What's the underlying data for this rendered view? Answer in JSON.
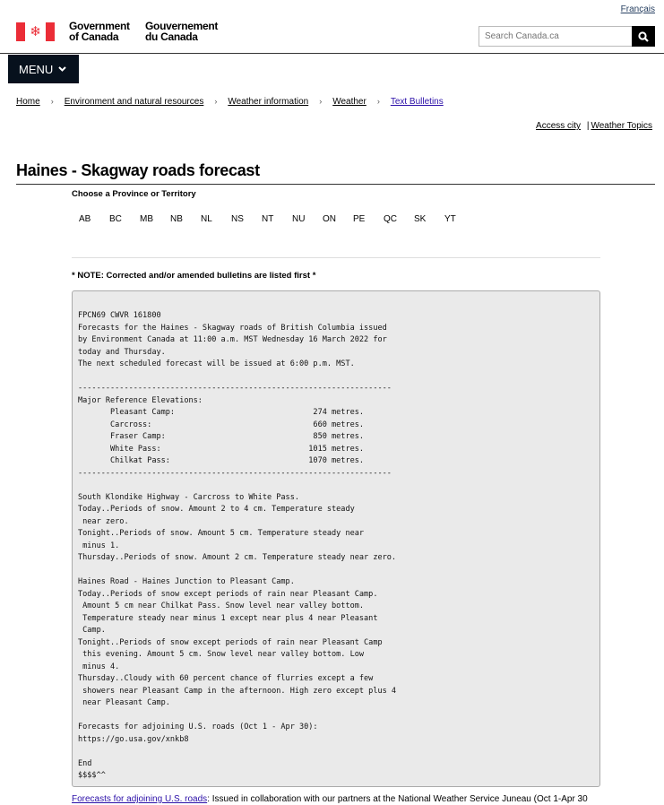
{
  "header": {
    "lang_link": "Français",
    "gov_en_1": "Government",
    "gov_en_2": "of Canada",
    "gov_fr_1": "Gouvernement",
    "gov_fr_2": "du Canada",
    "search_placeholder": "Search Canada.ca",
    "menu_label": "MENU"
  },
  "breadcrumb": [
    "Home",
    "Environment and natural resources",
    "Weather information",
    "Weather",
    "Text Bulletins"
  ],
  "top_links": {
    "access_city": "Access city",
    "sep": "|",
    "weather_topics": "Weather Topics"
  },
  "page_title": "Haines - Skagway roads forecast",
  "province_title": "Choose a Province or Territory",
  "provinces": [
    "AB",
    "BC",
    "MB",
    "NB",
    "NL",
    "NS",
    "NT",
    "NU",
    "ON",
    "PE",
    "QC",
    "SK",
    "YT"
  ],
  "note": "* NOTE: Corrected and/or amended bulletins are listed first *",
  "bulletin": "FPCN69 CWVR 161800\nForecasts for the Haines - Skagway roads of British Columbia issued\nby Environment Canada at 11:00 a.m. MST Wednesday 16 March 2022 for\ntoday and Thursday.\nThe next scheduled forecast will be issued at 6:00 p.m. MST.\n\n--------------------------------------------------------------------\nMajor Reference Elevations:\n       Pleasant Camp:                              274 metres.\n       Carcross:                                   660 metres.\n       Fraser Camp:                                850 metres.\n       White Pass:                                1015 metres.\n       Chilkat Pass:                              1070 metres.\n--------------------------------------------------------------------\n\nSouth Klondike Highway - Carcross to White Pass.\nToday..Periods of snow. Amount 2 to 4 cm. Temperature steady\n near zero.\nTonight..Periods of snow. Amount 5 cm. Temperature steady near\n minus 1.\nThursday..Periods of snow. Amount 2 cm. Temperature steady near zero.\n\nHaines Road - Haines Junction to Pleasant Camp.\nToday..Periods of snow except periods of rain near Pleasant Camp.\n Amount 5 cm near Chilkat Pass. Snow level near valley bottom.\n Temperature steady near minus 1 except near plus 4 near Pleasant\n Camp.\nTonight..Periods of snow except periods of rain near Pleasant Camp\n this evening. Amount 5 cm. Snow level near valley bottom. Low\n minus 4.\nThursday..Cloudy with 60 percent chance of flurries except a few\n showers near Pleasant Camp in the afternoon. High zero except plus 4\n near Pleasant Camp.\n\nForecasts for adjoining U.S. roads (Oct 1 - Apr 30):\nhttps://go.usa.gov/xnkb8\n\nEnd\n$$$$^^",
  "footer": {
    "link": "Forecasts for adjoining U.S. roads",
    "text": ": Issued in collaboration with our partners at the National Weather Service Juneau (Oct 1-Apr 30"
  }
}
